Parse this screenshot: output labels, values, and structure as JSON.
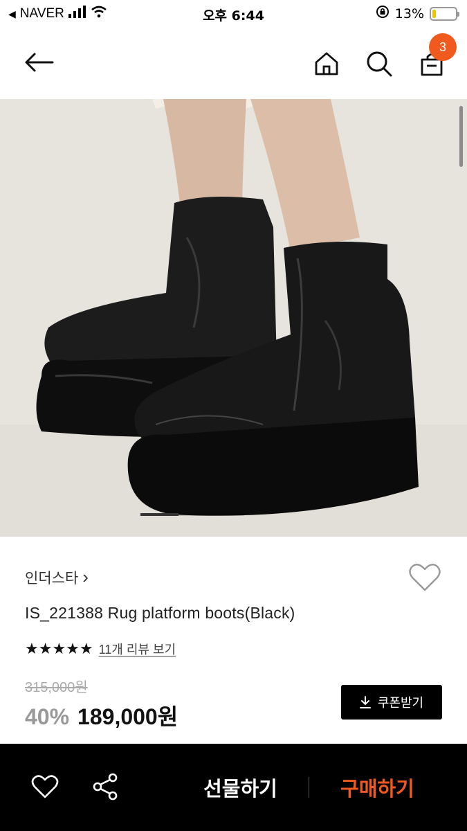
{
  "status_bar": {
    "back_app": "NAVER",
    "time": "오후 6:44",
    "battery": "13%"
  },
  "header": {
    "cart_count": "3",
    "icons": [
      "back-arrow-icon",
      "home-icon",
      "search-icon",
      "shopping-bag-icon"
    ]
  },
  "product": {
    "brand": "인더스타",
    "brand_chevron": "›",
    "name": "IS_221388 Rug platform boots(Black)",
    "stars": "★★★★★",
    "rating": 5,
    "review_link": "11개 리뷰 보기",
    "original_price": "315,000원",
    "discount": "40%",
    "price": "189,000원",
    "coupon_label": "쿠폰받기"
  },
  "bottom_bar": {
    "gift_label": "선물하기",
    "buy_label": "구매하기"
  },
  "colors": {
    "accent": "#f05a1e",
    "bottom_bar": "#000000",
    "coupon_button": "#000000"
  }
}
